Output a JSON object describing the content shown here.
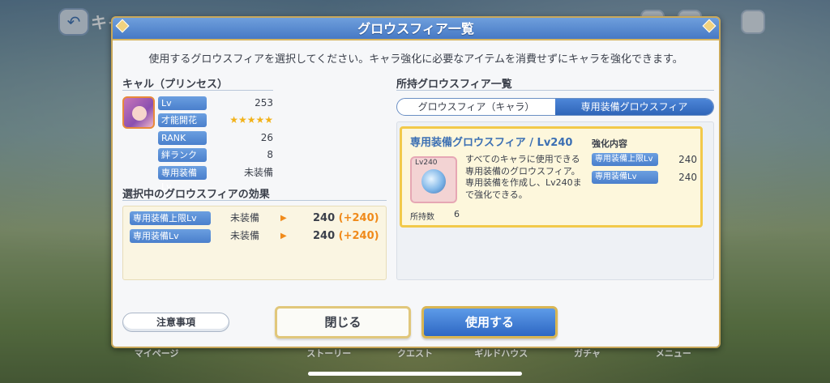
{
  "hud": {
    "back_icon": "back-arrow-icon",
    "title": "キャ"
  },
  "dialog": {
    "title": "グロウスフィア一覧",
    "instruction": "使用するグロウスフィアを選択してください。キャラ強化に必要なアイテムを消費せずにキャラを強化できます。"
  },
  "character": {
    "name": "キャル（プリンセス）",
    "stats": [
      {
        "label": "Lv",
        "value": "253"
      },
      {
        "label": "才能開花",
        "value": "★★★★★"
      },
      {
        "label": "RANK",
        "value": "26"
      },
      {
        "label": "絆ランク",
        "value": "8"
      },
      {
        "label": "専用装備Lv",
        "value": "未装備"
      }
    ]
  },
  "effect": {
    "title": "選択中のグロウスフィアの効果",
    "rows": [
      {
        "label": "専用装備上限Lv",
        "current": "未装備",
        "new_value": "240",
        "plus": "(+240)"
      },
      {
        "label": "専用装備Lv",
        "current": "未装備",
        "new_value": "240",
        "plus": "(+240)"
      }
    ]
  },
  "owned": {
    "title": "所持グロウスフィア一覧",
    "tabs": [
      {
        "label": "グロウスフィア（キャラ）",
        "selected": false
      },
      {
        "label": "専用装備グロウスフィア",
        "selected": true
      }
    ],
    "card": {
      "title": "専用装備グロウスフィア / Lv240",
      "icon_label": "Lv240",
      "description": "すべてのキャラに使用できる専用装備のグロウスフィア。専用装備を作成し、Lv240まで強化できる。",
      "owned_label": "所持数",
      "owned_count": "6",
      "enhance_title": "強化内容",
      "enhance_rows": [
        {
          "label": "専用装備上限Lv",
          "value": "240"
        },
        {
          "label": "専用装備Lv",
          "value": "240"
        }
      ]
    }
  },
  "buttons": {
    "notes": "注意事項",
    "close": "閉じる",
    "use": "使用する"
  },
  "bottom_nav": [
    "マイページ",
    "",
    "ストーリー",
    "クエスト",
    "ギルドハウス",
    "ガチャ",
    "メニュー"
  ],
  "colors": {
    "header_blue": "#4679c5",
    "accent_gold": "#d7b560",
    "label_blue": "#4a7fcc",
    "plus_orange": "#f08a1a",
    "star_gold": "#f2b21a"
  }
}
